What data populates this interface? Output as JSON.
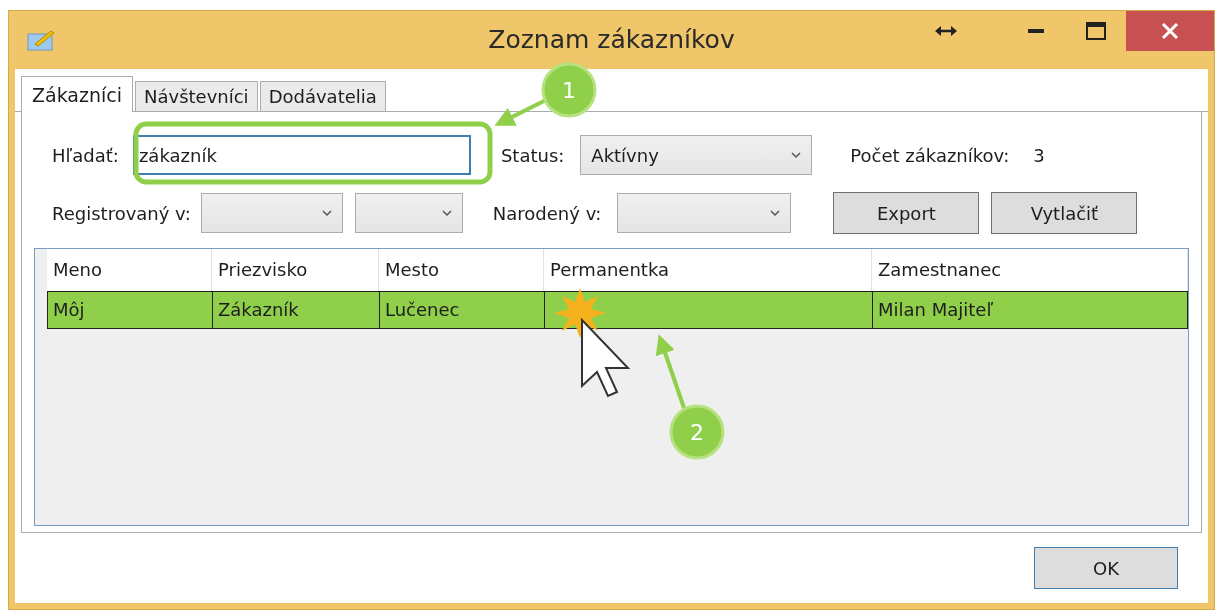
{
  "window": {
    "title": "Zoznam zákazníkov"
  },
  "tabs": [
    {
      "label": "Zákazníci",
      "selected": true
    },
    {
      "label": "Návštevníci",
      "selected": false
    },
    {
      "label": "Dodávatelia",
      "selected": false
    }
  ],
  "search": {
    "label": "Hľadať:",
    "value": "zákazník"
  },
  "status": {
    "label": "Status:",
    "value": "Aktívny"
  },
  "count": {
    "label": "Počet zákazníkov:",
    "value": "3"
  },
  "registered": {
    "label": "Registrovaný v:"
  },
  "born": {
    "label": "Narodený v:"
  },
  "actions": [
    "Export",
    "Vytlačiť"
  ],
  "table": {
    "columns": [
      "Meno",
      "Priezvisko",
      "Mesto",
      "Permanentka",
      "Zamestnanec"
    ],
    "rows": [
      {
        "cells": [
          "Môj",
          "Zákazník",
          "Lučenec",
          null,
          "Milan Majiteľ"
        ],
        "selected": true
      }
    ]
  },
  "footer_buttons": [
    "OK"
  ],
  "annotations": [
    {
      "label": "1"
    },
    {
      "label": "2"
    }
  ]
}
